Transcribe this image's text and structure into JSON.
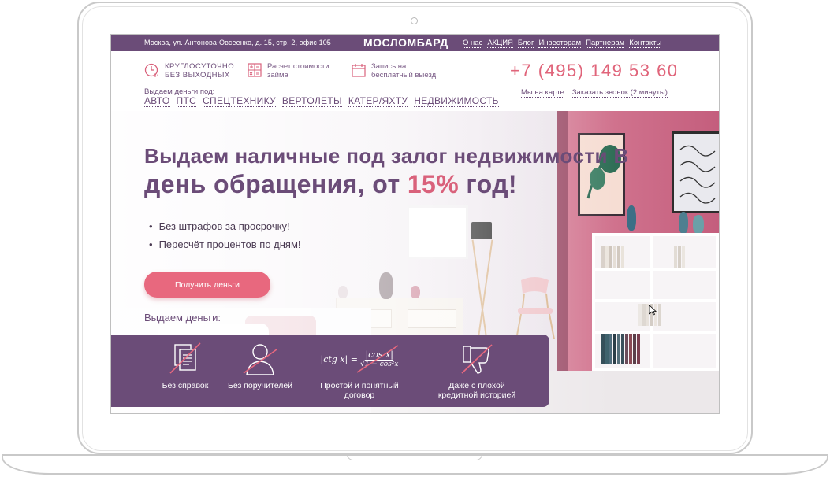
{
  "top_bar": {
    "address": "Москва, ул. Антонова-Овсеенко, д. 15, стр. 2, офис 105",
    "logo": "МОСЛОМБАРД",
    "nav": [
      "О нас",
      "АКЦИЯ",
      "Блог",
      "Инвесторам",
      "Партнерам",
      "Контакты"
    ]
  },
  "header": {
    "features": [
      {
        "icon": "clock-24-icon",
        "line1": "КРУГЛОСУТОЧНО",
        "line2": "БЕЗ ВЫХОДНЫХ"
      },
      {
        "icon": "calculator-icon",
        "line1": "Расчет стоимости",
        "line2": "займа"
      },
      {
        "icon": "calendar-icon",
        "line1": "Запись на",
        "line2": "бесплатный выезд"
      }
    ],
    "give_label": "Выдаем деньги под:",
    "give_list": [
      "АВТО",
      "ПТС",
      "СПЕЦТЕХНИКУ",
      "ВЕРТОЛЕТЫ",
      "КАТЕР/ЯХТУ",
      "НЕДВИЖИМОСТЬ"
    ],
    "phone": "+7 (495) 149 53 60",
    "map_link": "Мы на карте",
    "callback_link": "Заказать звонок (2 минуты)"
  },
  "hero": {
    "headline_part1": "Выдаем наличные под залог недвижимости В",
    "headline_part2": "день обращения, от ",
    "headline_accent": "15%",
    "headline_part3": " год!",
    "bullets": [
      "Без штрафов за просрочку!",
      "Пересчёт процентов по дням!"
    ],
    "cta_label": "Получить деньги",
    "give_money_label": "Выдаем деньги:"
  },
  "panel": {
    "items": [
      {
        "icon": "documents-crossed-icon",
        "label_line1": "Без справок",
        "label_line2": ""
      },
      {
        "icon": "person-crossed-icon",
        "label_line1": "Без поручителей",
        "label_line2": ""
      },
      {
        "icon": "formula-crossed-icon",
        "label_line1": "Простой и понятный",
        "label_line2": "договор"
      },
      {
        "icon": "thumbs-down-crossed-icon",
        "label_line1": "Даже с плохой",
        "label_line2": "кредитной историей"
      }
    ],
    "formula_left": "|ctg x| =",
    "formula_num": "|cos x|",
    "formula_den": "√1 − cos²x"
  },
  "colors": {
    "brand_purple": "#6b4c78",
    "accent_pink": "#e8687e",
    "phone_pink": "#e0647a"
  }
}
